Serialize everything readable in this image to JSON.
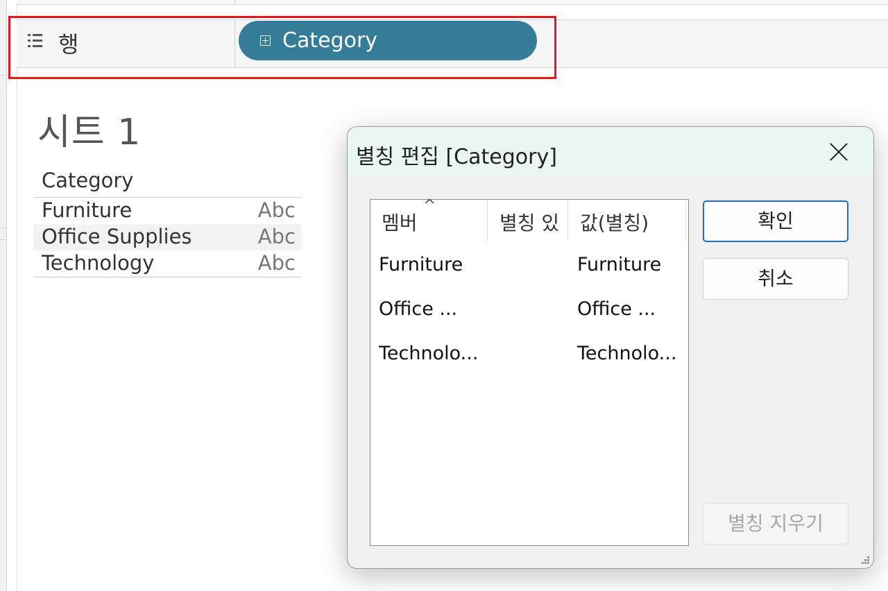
{
  "shelf": {
    "rows_label": "행",
    "pill_label": "Category"
  },
  "sheet": {
    "title": "시트 1",
    "column_header": "Category",
    "rows": [
      {
        "name": "Furniture",
        "type": "Abc"
      },
      {
        "name": "Office Supplies",
        "type": "Abc"
      },
      {
        "name": "Technology",
        "type": "Abc"
      }
    ]
  },
  "dialog": {
    "title": "별칭 편집 [Category]",
    "columns": [
      "멤버",
      "별칭 있",
      "값(별칭)"
    ],
    "sort_indicator": "^",
    "items": [
      {
        "member": "Furniture",
        "value": "Furniture"
      },
      {
        "member": "Office ...",
        "value": "Office ..."
      },
      {
        "member": "Technolo...",
        "value": "Technolo..."
      }
    ],
    "buttons": {
      "ok": "확인",
      "cancel": "취소",
      "clear": "별칭 지우기"
    }
  },
  "colors": {
    "pill": "#357c99",
    "highlight": "#e8141c",
    "primary_border": "#1a6fd4"
  }
}
